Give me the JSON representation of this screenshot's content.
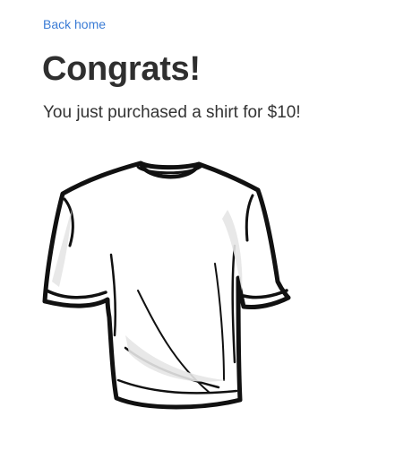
{
  "nav": {
    "back_label": "Back home"
  },
  "main": {
    "title": "Congrats!",
    "message": "You just purchased a shirt for $10!"
  },
  "image": {
    "icon": "t-shirt-illustration"
  },
  "colors": {
    "link": "#3a7bd5",
    "text": "#333333"
  }
}
